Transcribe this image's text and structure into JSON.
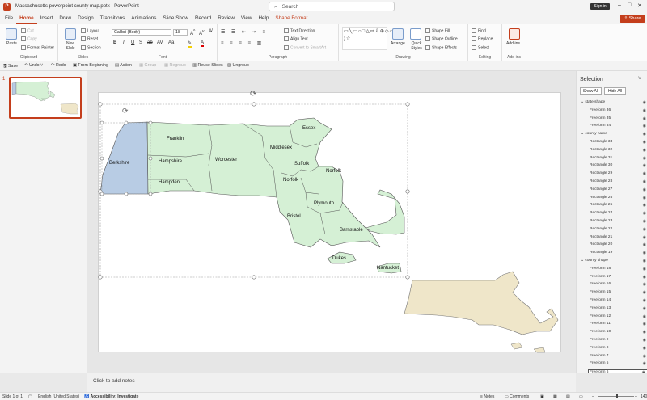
{
  "app": {
    "doc_title": "Massachusetts powerpoint county map.pptx",
    "app_name": "PowerPoint",
    "sign_in": "Sign in",
    "share": "Share"
  },
  "search": {
    "placeholder": "Search"
  },
  "tabs": [
    "File",
    "Home",
    "Insert",
    "Draw",
    "Design",
    "Transitions",
    "Animations",
    "Slide Show",
    "Record",
    "Review",
    "View",
    "Help",
    "Shape Format"
  ],
  "ribbon": {
    "clipboard": {
      "paste": "Paste",
      "cut": "Cut",
      "copy": "Copy",
      "format_painter": "Format Painter",
      "label": "Clipboard"
    },
    "slides": {
      "new_slide": "New Slide",
      "layout": "Layout",
      "reset": "Reset",
      "section": "Section",
      "label": "Slides"
    },
    "font": {
      "family": "Calibri (Body)",
      "size": "18",
      "label": "Font"
    },
    "paragraph": {
      "text_direction": "Text Direction",
      "align_text": "Align Text",
      "smartart": "Convert to SmartArt",
      "label": "Paragraph"
    },
    "drawing": {
      "arrange": "Arrange",
      "quick_styles": "Quick Styles",
      "shape_fill": "Shape Fill",
      "shape_outline": "Shape Outline",
      "shape_effects": "Shape Effects",
      "label": "Drawing"
    },
    "editing": {
      "find": "Find",
      "replace": "Replace",
      "select": "Select",
      "label": "Editing"
    },
    "addins": {
      "addins": "Add-ins",
      "label": "Add-ins"
    }
  },
  "qat": {
    "save": "Save",
    "undo": "Undo",
    "redo": "Redo",
    "from_beginning": "From Beginning",
    "action": "Action",
    "group": "Group",
    "regroup": "Regroup",
    "reuse_slides": "Reuse Slides",
    "ungroup": "Ungroup"
  },
  "thumbnail": {
    "number": "1"
  },
  "counties": [
    "Essex",
    "Franklin",
    "Middlesex",
    "Berkshire",
    "Hampshire",
    "Worcester",
    "Suffolk",
    "Norfolk",
    "Hampden",
    "Norfolk",
    "Plymouth",
    "Bristol",
    "Barnstable",
    "Dukes",
    "Nantucket"
  ],
  "notes": {
    "placeholder": "Click to add notes"
  },
  "selection_pane": {
    "title": "Selection",
    "show_all": "Show All",
    "hide_all": "Hide All",
    "rows": [
      {
        "label": "state shape",
        "type": "group"
      },
      {
        "label": "Freeform 36",
        "type": "item"
      },
      {
        "label": "Freeform 35",
        "type": "item"
      },
      {
        "label": "Freeform 34",
        "type": "item"
      },
      {
        "label": "county name",
        "type": "group"
      },
      {
        "label": "Rectangle 33",
        "type": "item"
      },
      {
        "label": "Rectangle 32",
        "type": "item"
      },
      {
        "label": "Rectangle 31",
        "type": "item"
      },
      {
        "label": "Rectangle 30",
        "type": "item"
      },
      {
        "label": "Rectangle 29",
        "type": "item"
      },
      {
        "label": "Rectangle 28",
        "type": "item"
      },
      {
        "label": "Rectangle 27",
        "type": "item"
      },
      {
        "label": "Rectangle 26",
        "type": "item"
      },
      {
        "label": "Rectangle 25",
        "type": "item"
      },
      {
        "label": "Rectangle 24",
        "type": "item"
      },
      {
        "label": "Rectangle 23",
        "type": "item"
      },
      {
        "label": "Rectangle 22",
        "type": "item"
      },
      {
        "label": "Rectangle 21",
        "type": "item"
      },
      {
        "label": "Rectangle 20",
        "type": "item"
      },
      {
        "label": "Rectangle 19",
        "type": "item"
      },
      {
        "label": "county shape",
        "type": "group"
      },
      {
        "label": "Freeform 18",
        "type": "item"
      },
      {
        "label": "Freeform 17",
        "type": "item"
      },
      {
        "label": "Freeform 16",
        "type": "item"
      },
      {
        "label": "Freeform 15",
        "type": "item"
      },
      {
        "label": "Freeform 14",
        "type": "item"
      },
      {
        "label": "Freeform 13",
        "type": "item"
      },
      {
        "label": "Freeform 12",
        "type": "item"
      },
      {
        "label": "Freeform 11",
        "type": "item"
      },
      {
        "label": "Freeform 10",
        "type": "item"
      },
      {
        "label": "Freeform 9",
        "type": "item"
      },
      {
        "label": "Freeform 8",
        "type": "item"
      },
      {
        "label": "Freeform 7",
        "type": "item"
      },
      {
        "label": "Freeform 5",
        "type": "item"
      },
      {
        "label": "Freeform 6",
        "type": "item",
        "selected": true
      }
    ]
  },
  "status": {
    "slide": "Slide 1 of 1",
    "language": "English (United States)",
    "accessibility": "Accessibility: Investigate",
    "notes": "Notes",
    "comments": "Comments",
    "zoom": "140"
  },
  "colors": {
    "accent": "#c43e1c",
    "county_fill": "#d5f0d5",
    "berkshire_fill": "#b8cce4",
    "state_fill": "#efe6c9"
  }
}
